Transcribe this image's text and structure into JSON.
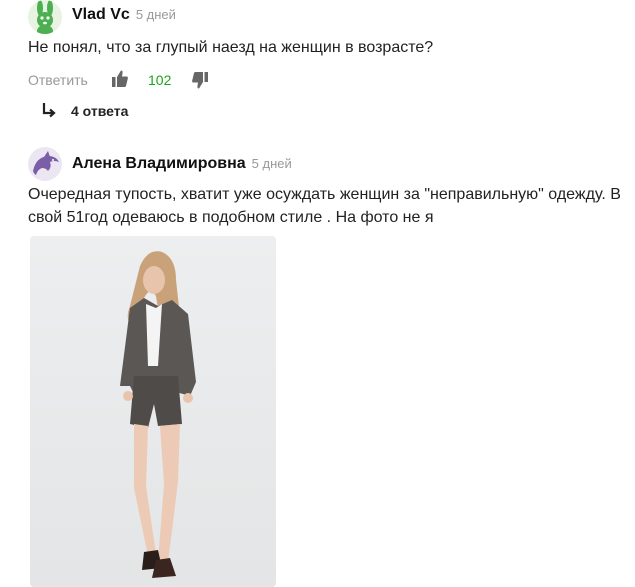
{
  "comments": [
    {
      "author": "Vlad Vc",
      "time": "5 дней",
      "text": "Не понял, что за глупый наезд на женщин в возрасте?",
      "avatar_icon": "rabbit-icon",
      "reply_label": "Ответить",
      "likes": "102",
      "replies_label": "4 ответа"
    },
    {
      "author": "Алена Владимировна",
      "time": "5 дней",
      "text": "Очередная тупость, хватит уже осуждать женщин за \"неправильную\" одежду. В свой 51год одеваюсь в подобном стиле . На фото не я",
      "avatar_icon": "dolphin-icon",
      "photo_icon": "woman-in-tweed-suit-photo"
    }
  ],
  "colors": {
    "like_count": "#1aa51a",
    "muted": "#999999",
    "rabbit_avatar": "#4caf50",
    "dolphin_avatar": "#7b5ea7"
  }
}
